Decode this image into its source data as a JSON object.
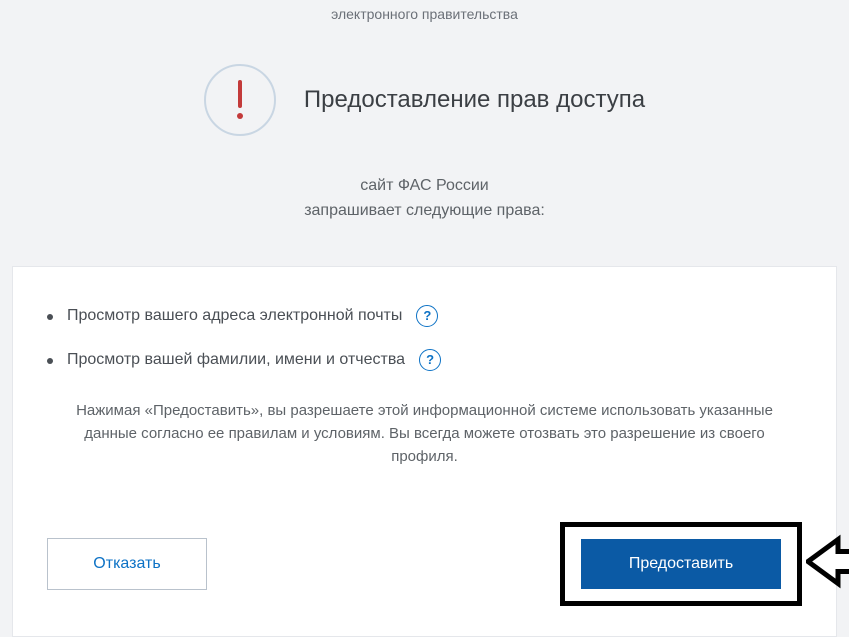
{
  "header": {
    "caption": "электронного правительства"
  },
  "hero": {
    "title": "Предоставление прав доступа"
  },
  "subtitle": {
    "site_name": "сайт ФАС России",
    "requests": "запрашивает следующие права:"
  },
  "permissions": [
    {
      "text": "Просмотр вашего адреса электронной почты"
    },
    {
      "text": "Просмотр вашей фамилии, имени и отчества"
    }
  ],
  "disclaimer": {
    "text": "Нажимая «Предоставить», вы разрешаете этой информационной системе использовать указанные данные согласно ее правилам и условиям. Вы всегда можете отозвать это разрешение из своего профиля."
  },
  "actions": {
    "decline_label": "Отказать",
    "accept_label": "Предоставить"
  },
  "icons": {
    "help_glyph": "?"
  }
}
